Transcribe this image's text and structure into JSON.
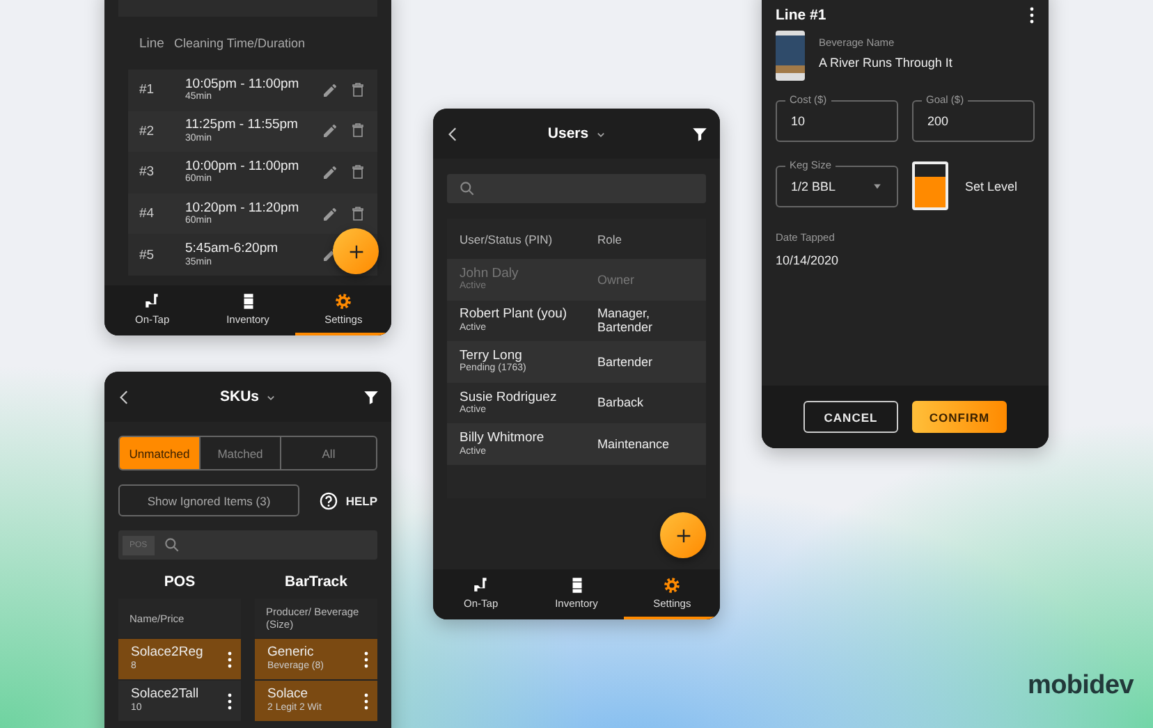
{
  "cleaning": {
    "columns": [
      "Line",
      "Cleaning Time/Duration"
    ],
    "rows": [
      {
        "line": "#1",
        "time": "10:05pm - 11:00pm",
        "duration": "45min"
      },
      {
        "line": "#2",
        "time": "11:25pm - 11:55pm",
        "duration": "30min"
      },
      {
        "line": "#3",
        "time": "10:00pm - 11:00pm",
        "duration": "60min"
      },
      {
        "line": "#4",
        "time": "10:20pm - 11:20pm",
        "duration": "60min"
      },
      {
        "line": "#5",
        "time": "5:45am-6:20pm",
        "duration": "35min"
      }
    ],
    "nav": [
      {
        "label": "On-Tap",
        "selected": false
      },
      {
        "label": "Inventory",
        "selected": false
      },
      {
        "label": "Settings",
        "selected": true
      }
    ]
  },
  "skus": {
    "title": "SKUs",
    "segments": [
      {
        "label": "Unmatched",
        "selected": true
      },
      {
        "label": "Matched",
        "selected": false
      },
      {
        "label": "All",
        "selected": false
      }
    ],
    "ignored_button": "Show Ignored Items (3)",
    "help": "HELP",
    "search_chip": "POS",
    "columns": [
      {
        "heading": "POS",
        "column": "Name/Price",
        "items": [
          {
            "name": "Solace2Reg",
            "detail": "8",
            "selected": true
          },
          {
            "name": "Solace2Tall",
            "detail": "10",
            "selected": false
          }
        ]
      },
      {
        "heading": "BarTrack",
        "column": "Producer/ Beverage (Size)",
        "items": [
          {
            "name": "Generic",
            "detail": "Beverage (8)",
            "selected": true
          },
          {
            "name": "Solace",
            "detail": "2 Legit 2 Wit",
            "selected": true
          }
        ]
      }
    ]
  },
  "users": {
    "title": "Users",
    "columns": [
      "User/Status (PIN)",
      "Role"
    ],
    "rows": [
      {
        "name": "John Daly",
        "status": "Active",
        "role": "Owner",
        "disabled": true
      },
      {
        "name": "Robert Plant (you)",
        "status": "Active",
        "role": "Manager, Bartender",
        "disabled": false
      },
      {
        "name": "Terry Long",
        "status": "Pending (1763)",
        "role": "Bartender",
        "disabled": false
      },
      {
        "name": "Susie Rodriguez",
        "status": "Active",
        "role": "Barback",
        "disabled": false
      },
      {
        "name": "Billy Whitmore",
        "status": "Active",
        "role": "Maintenance",
        "disabled": false
      }
    ],
    "nav": [
      {
        "label": "On-Tap",
        "selected": false
      },
      {
        "label": "Inventory",
        "selected": false
      },
      {
        "label": "Settings",
        "selected": true
      }
    ]
  },
  "line_editor": {
    "title": "Line #1",
    "beverage_label": "Beverage Name",
    "beverage": "A River Runs Through It",
    "cost": {
      "label": "Cost ($)",
      "value": "10"
    },
    "goal": {
      "label": "Goal ($)",
      "value": "200"
    },
    "keg_size": {
      "label": "Keg Size",
      "value": "1/2 BBL"
    },
    "level": 0.7,
    "set_level": "Set Level",
    "date_label": "Date Tapped",
    "date": "10/14/2020",
    "buttons": [
      "CANCEL",
      "CONFIRM"
    ]
  },
  "logo": "mobidev"
}
